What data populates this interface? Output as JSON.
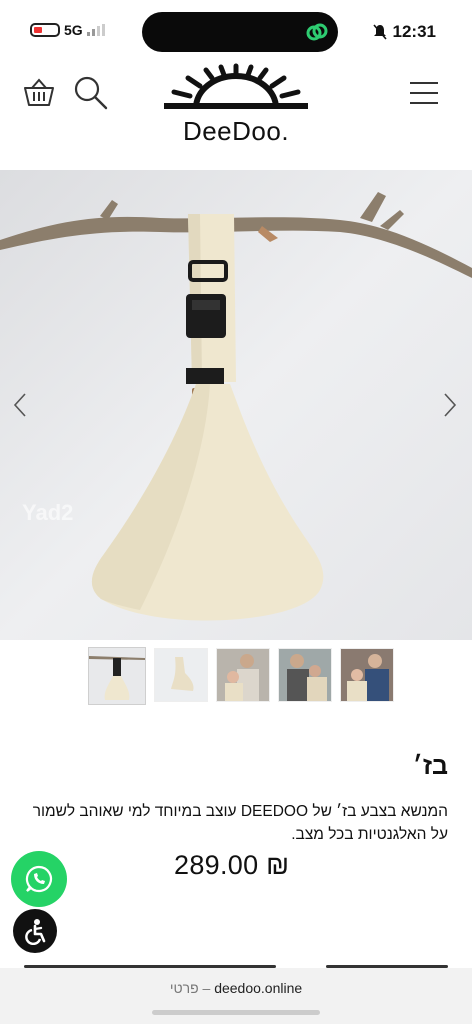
{
  "status_bar": {
    "network": "5G",
    "time": "12:31"
  },
  "header": {
    "logo_text": "DeeDoo."
  },
  "product": {
    "title": "בז׳",
    "description": "המנשא בצבע בז׳ של DEEDOO עוצב במיוחד למי שאוהב לשמור על האלגנטיות בכל מצב.",
    "price": "289.00 ₪",
    "watermark": "Yad2"
  },
  "browser": {
    "domain": "deedoo.online",
    "separator": "–",
    "page_label": "פרטי"
  },
  "colors": {
    "whatsapp": "#25d366",
    "hero_bg": "#e9eaec",
    "fabric": "#efe7cf"
  },
  "icons": [
    "cart-icon",
    "search-icon",
    "menu-icon",
    "chevron-left-icon",
    "chevron-right-icon",
    "whatsapp-icon",
    "accessibility-icon",
    "link-icon"
  ]
}
